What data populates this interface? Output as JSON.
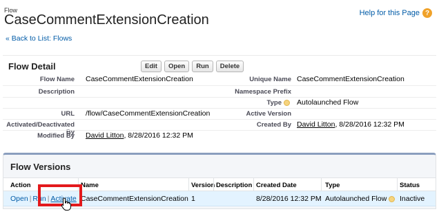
{
  "header": {
    "eyebrow": "Flow",
    "title": "CaseCommentExtensionCreation",
    "help_label": "Help for this Page",
    "help_icon": "help-icon",
    "back_link": "« Back to List: Flows"
  },
  "detail": {
    "title": "Flow Detail",
    "buttons": [
      "Edit",
      "Open",
      "Run",
      "Delete"
    ],
    "fields": {
      "flow_name_label": "Flow Name",
      "flow_name": "CaseCommentExtensionCreation",
      "description_label": "Description",
      "description": "",
      "url_label": "URL",
      "url": "/flow/CaseCommentExtensionCreation",
      "activated_label": "Activated/Deactivated By",
      "activated": "",
      "modified_label": "Modified By",
      "modified_user": "David Litton",
      "modified_date": ", 8/28/2016 12:32 PM",
      "unique_name_label": "Unique Name",
      "unique_name": "CaseCommentExtensionCreation",
      "namespace_label": "Namespace Prefix",
      "namespace": "",
      "type_label": "Type",
      "type": "Autolaunched Flow",
      "active_version_label": "Active Version",
      "active_version": "",
      "created_label": "Created By",
      "created_user": "David Litton",
      "created_date": ", 8/28/2016 12:32 PM"
    }
  },
  "versions": {
    "title": "Flow Versions",
    "columns": [
      "Action",
      "Name",
      "Version",
      "Description",
      "Created Date",
      "Type",
      "Status"
    ],
    "row": {
      "action_open": "Open",
      "action_run": "Run",
      "action_activate": "Activate",
      "name": "CaseCommentExtensionCreation",
      "version": "1",
      "description": "",
      "created_date": "8/28/2016 12:32 PM",
      "type": "Autolaunched Flow",
      "status": "Inactive"
    }
  },
  "colors": {
    "link": "#015ba7",
    "highlight": "#e3191c",
    "row_bg": "#e3f3ff",
    "panel_accent": "#8a9ebe"
  }
}
